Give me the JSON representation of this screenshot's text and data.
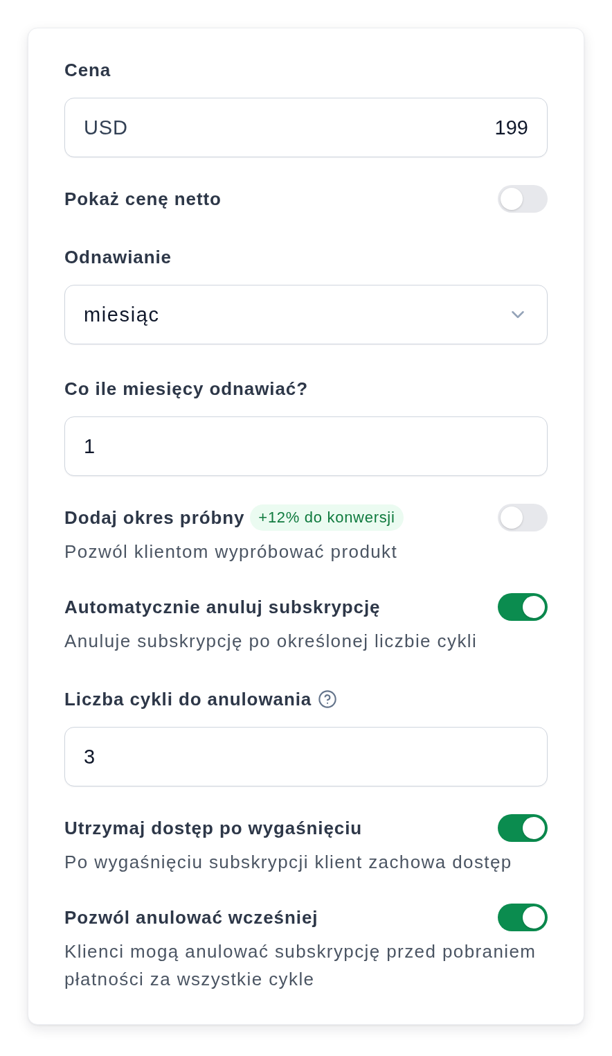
{
  "fields": [
    {
      "kind": "input",
      "label": "Cena",
      "prefix": "USD",
      "value": "199"
    },
    {
      "kind": "toggle",
      "label": "Pokaż cenę netto",
      "on": false
    },
    {
      "kind": "select",
      "label": "Odnawianie",
      "value": "miesiąc"
    },
    {
      "kind": "input",
      "label": "Co ile miesięcy odnawiać?",
      "value": "1"
    },
    {
      "kind": "toggle",
      "label": "Dodaj okres próbny",
      "badge": "+12% do konwersji",
      "description": "Pozwól klientom wypróbować produkt",
      "on": false
    },
    {
      "kind": "toggle",
      "label": "Automatycznie anuluj subskrypcję",
      "description": "Anuluje subskrypcję po określonej liczbie cykli",
      "on": true
    },
    {
      "kind": "input",
      "label": "Liczba cykli do anulowania",
      "help": true,
      "value": "3"
    },
    {
      "kind": "toggle",
      "label": "Utrzymaj dostęp po wygaśnięciu",
      "description": "Po wygaśnięciu subskrypcji klient zachowa dostęp",
      "on": true
    },
    {
      "kind": "toggle",
      "label": "Pozwól anulować wcześniej",
      "description": "Klienci mogą anulować subskrypcję przed pobraniem płatności za wszystkie cykle",
      "on": true
    }
  ]
}
